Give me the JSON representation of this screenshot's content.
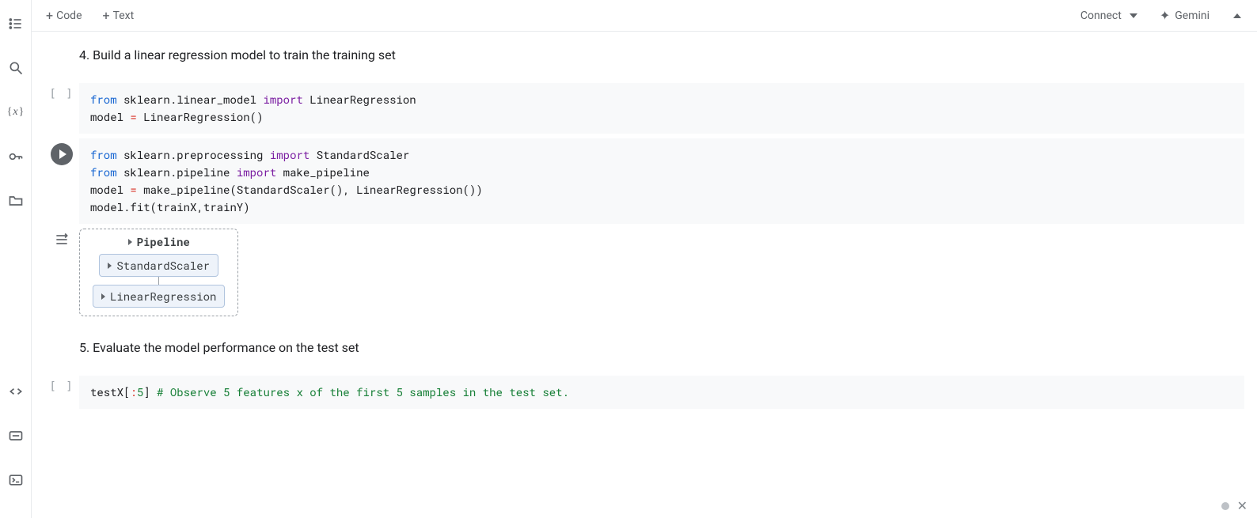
{
  "toolbar": {
    "code_label": "Code",
    "text_label": "Text",
    "connect_label": "Connect",
    "gemini_label": "Gemini"
  },
  "rail": {
    "var_symbol": "x"
  },
  "sections": {
    "heading4": "4. Build a linear regression model to train the training set",
    "heading5": "5. Evaluate the model performance on the test set"
  },
  "cells": {
    "c1": {
      "from1": "from",
      "mod1": "sklearn.linear_model",
      "imp1": "import",
      "obj1": "LinearRegression",
      "line2a": "model",
      "eq": "=",
      "call2": "LinearRegression",
      "par_open": "(",
      "par_close": ")"
    },
    "c2": {
      "l1_from": "from",
      "l1_mod": "sklearn.preprocessing",
      "l1_imp": "import",
      "l1_obj": "StandardScaler",
      "l2_from": "from",
      "l2_mod": "sklearn.pipeline",
      "l2_imp": "import",
      "l2_obj": "make_pipeline",
      "l3_var": "model",
      "l3_eq": "=",
      "l3_fn": "make_pipeline",
      "l3_arg1": "StandardScaler",
      "l3_arg2": "LinearRegression",
      "l4_obj": "model",
      "l4_dot": ".",
      "l4_fn": "fit",
      "l4_a1": "trainX",
      "l4_comma": ",",
      "l4_a2": "trainY"
    },
    "c3": {
      "var": "testX",
      "slice_open": "[",
      "colon": ":",
      "num": "5",
      "slice_close": "]",
      "comment": "# Observe 5 features x of the first 5 samples in the test set."
    }
  },
  "output": {
    "title": "Pipeline",
    "stage1": "StandardScaler",
    "stage2": "LinearRegression"
  },
  "gutter": {
    "empty": "[ ]"
  }
}
